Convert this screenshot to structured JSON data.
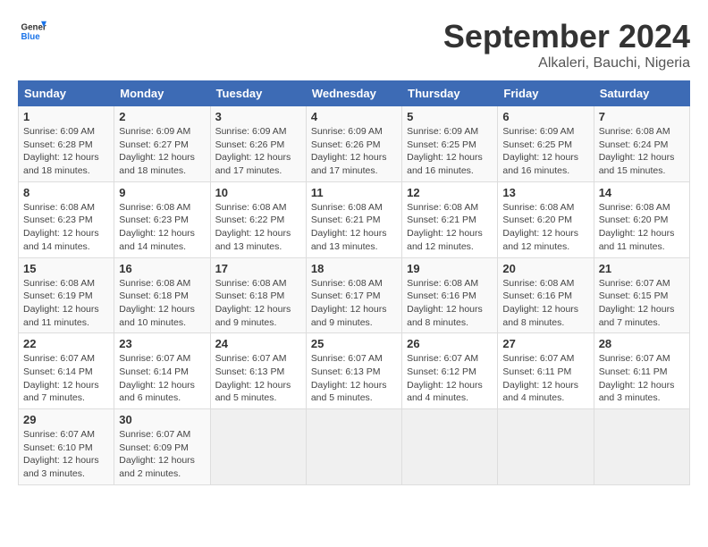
{
  "header": {
    "logo_line1": "General",
    "logo_line2": "Blue",
    "month": "September 2024",
    "location": "Alkaleri, Bauchi, Nigeria"
  },
  "weekdays": [
    "Sunday",
    "Monday",
    "Tuesday",
    "Wednesday",
    "Thursday",
    "Friday",
    "Saturday"
  ],
  "weeks": [
    [
      {
        "day": "1",
        "sunrise": "Sunrise: 6:09 AM",
        "sunset": "Sunset: 6:28 PM",
        "daylight": "Daylight: 12 hours and 18 minutes."
      },
      {
        "day": "2",
        "sunrise": "Sunrise: 6:09 AM",
        "sunset": "Sunset: 6:27 PM",
        "daylight": "Daylight: 12 hours and 18 minutes."
      },
      {
        "day": "3",
        "sunrise": "Sunrise: 6:09 AM",
        "sunset": "Sunset: 6:26 PM",
        "daylight": "Daylight: 12 hours and 17 minutes."
      },
      {
        "day": "4",
        "sunrise": "Sunrise: 6:09 AM",
        "sunset": "Sunset: 6:26 PM",
        "daylight": "Daylight: 12 hours and 17 minutes."
      },
      {
        "day": "5",
        "sunrise": "Sunrise: 6:09 AM",
        "sunset": "Sunset: 6:25 PM",
        "daylight": "Daylight: 12 hours and 16 minutes."
      },
      {
        "day": "6",
        "sunrise": "Sunrise: 6:09 AM",
        "sunset": "Sunset: 6:25 PM",
        "daylight": "Daylight: 12 hours and 16 minutes."
      },
      {
        "day": "7",
        "sunrise": "Sunrise: 6:08 AM",
        "sunset": "Sunset: 6:24 PM",
        "daylight": "Daylight: 12 hours and 15 minutes."
      }
    ],
    [
      {
        "day": "8",
        "sunrise": "Sunrise: 6:08 AM",
        "sunset": "Sunset: 6:23 PM",
        "daylight": "Daylight: 12 hours and 14 minutes."
      },
      {
        "day": "9",
        "sunrise": "Sunrise: 6:08 AM",
        "sunset": "Sunset: 6:23 PM",
        "daylight": "Daylight: 12 hours and 14 minutes."
      },
      {
        "day": "10",
        "sunrise": "Sunrise: 6:08 AM",
        "sunset": "Sunset: 6:22 PM",
        "daylight": "Daylight: 12 hours and 13 minutes."
      },
      {
        "day": "11",
        "sunrise": "Sunrise: 6:08 AM",
        "sunset": "Sunset: 6:21 PM",
        "daylight": "Daylight: 12 hours and 13 minutes."
      },
      {
        "day": "12",
        "sunrise": "Sunrise: 6:08 AM",
        "sunset": "Sunset: 6:21 PM",
        "daylight": "Daylight: 12 hours and 12 minutes."
      },
      {
        "day": "13",
        "sunrise": "Sunrise: 6:08 AM",
        "sunset": "Sunset: 6:20 PM",
        "daylight": "Daylight: 12 hours and 12 minutes."
      },
      {
        "day": "14",
        "sunrise": "Sunrise: 6:08 AM",
        "sunset": "Sunset: 6:20 PM",
        "daylight": "Daylight: 12 hours and 11 minutes."
      }
    ],
    [
      {
        "day": "15",
        "sunrise": "Sunrise: 6:08 AM",
        "sunset": "Sunset: 6:19 PM",
        "daylight": "Daylight: 12 hours and 11 minutes."
      },
      {
        "day": "16",
        "sunrise": "Sunrise: 6:08 AM",
        "sunset": "Sunset: 6:18 PM",
        "daylight": "Daylight: 12 hours and 10 minutes."
      },
      {
        "day": "17",
        "sunrise": "Sunrise: 6:08 AM",
        "sunset": "Sunset: 6:18 PM",
        "daylight": "Daylight: 12 hours and 9 minutes."
      },
      {
        "day": "18",
        "sunrise": "Sunrise: 6:08 AM",
        "sunset": "Sunset: 6:17 PM",
        "daylight": "Daylight: 12 hours and 9 minutes."
      },
      {
        "day": "19",
        "sunrise": "Sunrise: 6:08 AM",
        "sunset": "Sunset: 6:16 PM",
        "daylight": "Daylight: 12 hours and 8 minutes."
      },
      {
        "day": "20",
        "sunrise": "Sunrise: 6:08 AM",
        "sunset": "Sunset: 6:16 PM",
        "daylight": "Daylight: 12 hours and 8 minutes."
      },
      {
        "day": "21",
        "sunrise": "Sunrise: 6:07 AM",
        "sunset": "Sunset: 6:15 PM",
        "daylight": "Daylight: 12 hours and 7 minutes."
      }
    ],
    [
      {
        "day": "22",
        "sunrise": "Sunrise: 6:07 AM",
        "sunset": "Sunset: 6:14 PM",
        "daylight": "Daylight: 12 hours and 7 minutes."
      },
      {
        "day": "23",
        "sunrise": "Sunrise: 6:07 AM",
        "sunset": "Sunset: 6:14 PM",
        "daylight": "Daylight: 12 hours and 6 minutes."
      },
      {
        "day": "24",
        "sunrise": "Sunrise: 6:07 AM",
        "sunset": "Sunset: 6:13 PM",
        "daylight": "Daylight: 12 hours and 5 minutes."
      },
      {
        "day": "25",
        "sunrise": "Sunrise: 6:07 AM",
        "sunset": "Sunset: 6:13 PM",
        "daylight": "Daylight: 12 hours and 5 minutes."
      },
      {
        "day": "26",
        "sunrise": "Sunrise: 6:07 AM",
        "sunset": "Sunset: 6:12 PM",
        "daylight": "Daylight: 12 hours and 4 minutes."
      },
      {
        "day": "27",
        "sunrise": "Sunrise: 6:07 AM",
        "sunset": "Sunset: 6:11 PM",
        "daylight": "Daylight: 12 hours and 4 minutes."
      },
      {
        "day": "28",
        "sunrise": "Sunrise: 6:07 AM",
        "sunset": "Sunset: 6:11 PM",
        "daylight": "Daylight: 12 hours and 3 minutes."
      }
    ],
    [
      {
        "day": "29",
        "sunrise": "Sunrise: 6:07 AM",
        "sunset": "Sunset: 6:10 PM",
        "daylight": "Daylight: 12 hours and 3 minutes."
      },
      {
        "day": "30",
        "sunrise": "Sunrise: 6:07 AM",
        "sunset": "Sunset: 6:09 PM",
        "daylight": "Daylight: 12 hours and 2 minutes."
      },
      null,
      null,
      null,
      null,
      null
    ]
  ]
}
